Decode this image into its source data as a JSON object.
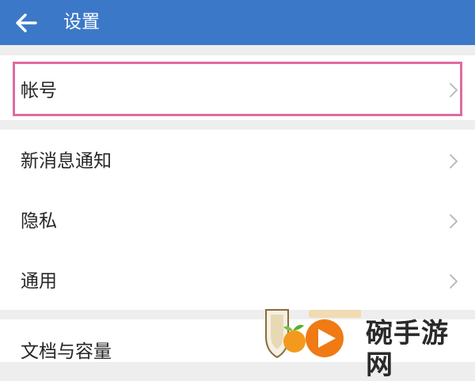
{
  "header": {
    "title": "设置",
    "back_icon": "arrow-left-icon",
    "color": "#3c78c8"
  },
  "settings": {
    "account": {
      "label": "帐号"
    },
    "notifications": {
      "label": "新消息通知"
    },
    "privacy": {
      "label": "隐私"
    },
    "general": {
      "label": "通用"
    },
    "storage": {
      "label": "文档与容量"
    }
  },
  "highlight_color": "#e06aa2",
  "watermark": {
    "text": "碗手游网"
  }
}
